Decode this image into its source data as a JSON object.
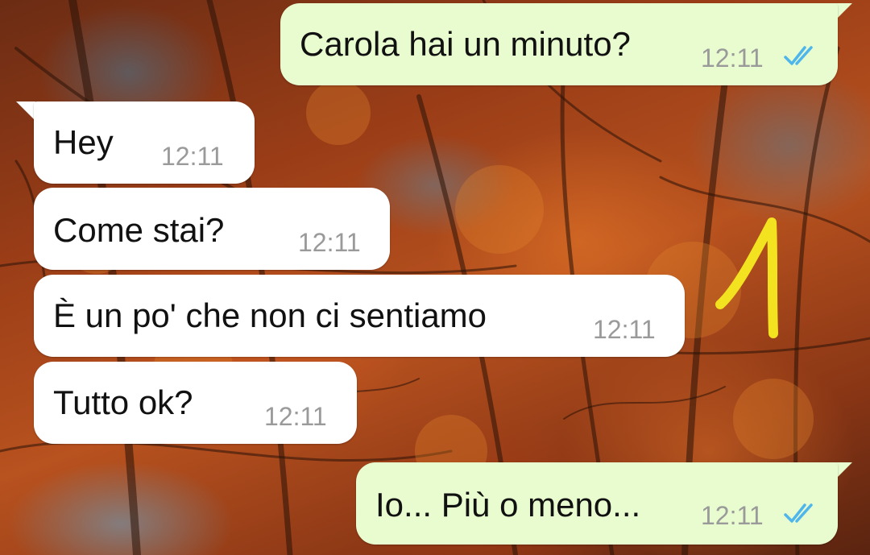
{
  "messages": [
    {
      "direction": "outgoing",
      "text": "Carola hai un minuto?",
      "time": "12:11",
      "status": "read"
    },
    {
      "direction": "incoming",
      "text": "Hey",
      "time": "12:11"
    },
    {
      "direction": "incoming",
      "text": "Come stai?",
      "time": "12:11"
    },
    {
      "direction": "incoming",
      "text": "È un po' che non ci sentiamo",
      "time": "12:11"
    },
    {
      "direction": "incoming",
      "text": "Tutto ok?",
      "time": "12:11"
    },
    {
      "direction": "outgoing",
      "text": "Io... Più o meno...",
      "time": "12:11",
      "status": "read"
    }
  ],
  "annotation": {
    "text": "1",
    "color": "#f2e21f"
  },
  "colors": {
    "incoming_bubble": "#ffffff",
    "outgoing_bubble": "#e8fccf",
    "read_ticks": "#4fb6ec",
    "timestamp": "#9a9a9a"
  },
  "icons": {
    "read_status": "double-check-icon"
  }
}
